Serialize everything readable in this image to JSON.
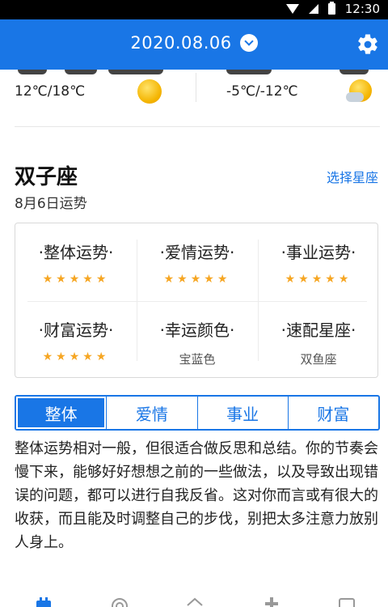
{
  "status_bar": {
    "time": "12:30"
  },
  "header": {
    "date": "2020.08.06"
  },
  "weather": {
    "left": {
      "temp": "12℃/18℃",
      "icon": "sun-icon"
    },
    "right": {
      "temp": "-5℃/-12℃",
      "icon": "sun-cloud-icon"
    }
  },
  "zodiac": {
    "name": "双子座",
    "date_label": "8月6日运势",
    "select_label": "选择星座"
  },
  "fortune_grid": {
    "items": [
      {
        "label": "·整体运势·",
        "stars": "★★★★★",
        "rating": 5
      },
      {
        "label": "·爱情运势·",
        "stars": "★★★★★",
        "rating": 5
      },
      {
        "label": "·事业运势·",
        "stars": "★★★★★",
        "rating": 5
      },
      {
        "label": "·财富运势·",
        "stars": "★★★★★",
        "rating": 5
      },
      {
        "label": "·幸运颜色·",
        "value": "宝蓝色"
      },
      {
        "label": "·速配星座·",
        "value": "双鱼座"
      }
    ]
  },
  "tabs": [
    {
      "label": "整体",
      "active": true
    },
    {
      "label": "爱情",
      "active": false
    },
    {
      "label": "事业",
      "active": false
    },
    {
      "label": "财富",
      "active": false
    }
  ],
  "description": "整体运势相对一般，但很适合做反思和总结。你的节奏会慢下来，能够好好想想之前的一些做法，以及导致出现错误的问题，都可以进行自我反省。这对你而言或有很大的收获，而且能及时调整自己的步伐，别把太多注意力放别人身上。",
  "colors": {
    "primary": "#1976e6",
    "star": "#f6a623"
  }
}
